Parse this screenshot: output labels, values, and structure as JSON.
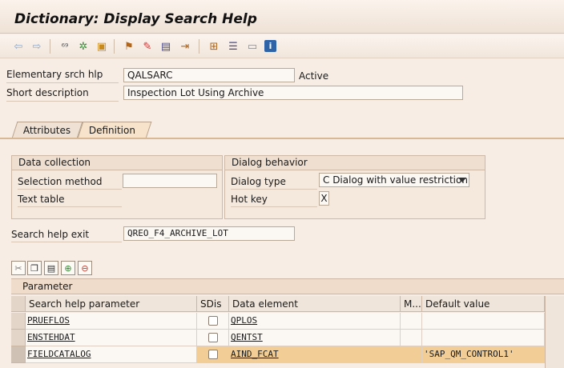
{
  "window": {
    "title": "Dictionary: Display Search Help"
  },
  "toolbar": {
    "icons": [
      "back-arrow-icon",
      "forward-arrow-icon",
      "other-object-icon",
      "display-change-icon",
      "active-inactive-icon",
      "where-used-icon",
      "edit-pencil-icon",
      "object-list-icon",
      "navigation-icon",
      "hierarchy-icon",
      "display-object-list-icon",
      "documentation-icon",
      "info-icon"
    ]
  },
  "header": {
    "search_help_label": "Elementary srch hlp",
    "search_help_value": "QALSARC",
    "status": "Active",
    "short_desc_label": "Short description",
    "short_desc_value": "Inspection Lot Using Archive"
  },
  "tabs": [
    {
      "label": "Attributes",
      "active": false
    },
    {
      "label": "Definition",
      "active": true
    }
  ],
  "data_collection": {
    "title": "Data collection",
    "selection_method_label": "Selection method",
    "selection_method_value": "",
    "text_table_label": "Text table",
    "text_table_value": ""
  },
  "dialog_behavior": {
    "title": "Dialog behavior",
    "dialog_type_label": "Dialog type",
    "dialog_type_value": "C Dialog with value restriction",
    "hot_key_label": "Hot key",
    "hot_key_value": "X"
  },
  "exit": {
    "label": "Search help exit",
    "value": "QREO_F4_ARCHIVE_LOT"
  },
  "table_toolbar": {
    "icons": [
      "cut-icon",
      "copy-icon",
      "paste-icon",
      "insert-row-icon",
      "delete-row-icon"
    ]
  },
  "parameters": {
    "title": "Parameter",
    "columns": [
      "Search help parameter",
      "SDis",
      "Data element",
      "M...",
      "Default value"
    ],
    "rows": [
      {
        "param": "PRUEFLOS",
        "sdis": false,
        "data_element": "QPLOS",
        "mod": "",
        "default": ""
      },
      {
        "param": "ENSTEHDAT",
        "sdis": false,
        "data_element": "QENTST",
        "mod": "",
        "default": ""
      },
      {
        "param": "FIELDCATALOG",
        "sdis": false,
        "data_element": "AIND_FCAT",
        "mod": "",
        "default": "'SAP_QM_CONTROL1'"
      }
    ]
  },
  "colors": {
    "background": "#f7ede4",
    "selected_row": "#f2ce96",
    "tab_active": "#f7e3cb"
  }
}
